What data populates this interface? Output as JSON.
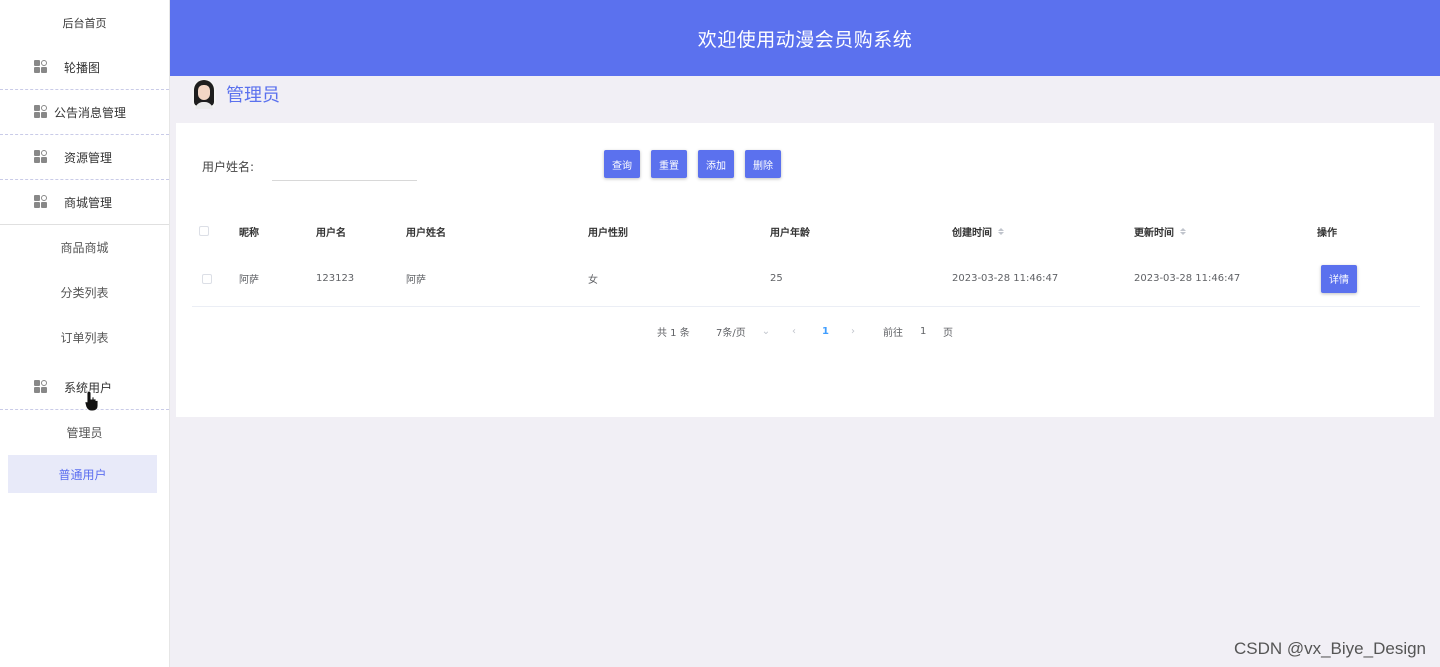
{
  "sidebar": {
    "home": "后台首页",
    "groups": [
      {
        "label": "轮播图"
      },
      {
        "label": "公告消息管理"
      },
      {
        "label": "资源管理"
      },
      {
        "label": "商城管理"
      },
      {
        "label": "系统用户"
      }
    ],
    "mall_items": [
      "商品商城",
      "分类列表",
      "订单列表"
    ],
    "user_items": [
      "管理员",
      "普通用户"
    ]
  },
  "header": {
    "title": "欢迎使用动漫会员购系统"
  },
  "breadcrumb": {
    "title": "管理员"
  },
  "search": {
    "label": "用户姓名:",
    "value": "",
    "placeholder": ""
  },
  "toolbar": {
    "query": "查询",
    "reset": "重置",
    "add": "添加",
    "delete": "删除"
  },
  "table": {
    "headers": {
      "nickname": "昵称",
      "username": "用户名",
      "realname": "用户姓名",
      "gender": "用户性别",
      "age": "用户年龄",
      "created": "创建时间",
      "updated": "更新时间",
      "action": "操作"
    },
    "rows": [
      {
        "nickname": "阿萨",
        "username": "123123",
        "realname": "阿萨",
        "gender": "女",
        "age": "25",
        "created": "2023-03-28 11:46:47",
        "updated": "2023-03-28 11:46:47",
        "action": "详情"
      }
    ]
  },
  "pagination": {
    "total": "共 1 条",
    "page_size": "7条/页",
    "current": "1",
    "goto_prefix": "前往",
    "goto_value": "1",
    "goto_suffix": "页"
  },
  "watermark": "CSDN @vx_Biye_Design",
  "colors": {
    "primary": "#5b71ee",
    "background": "#f1eff5",
    "link": "#409eff"
  }
}
